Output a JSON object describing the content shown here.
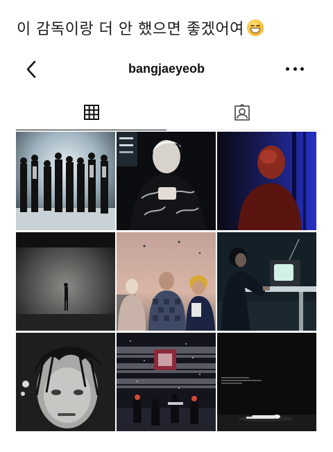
{
  "post": {
    "caption": "이 감독이랑 더 안 했으면 좋겠어여",
    "emoji": "grinning-face-with-smiling-eyes"
  },
  "profile": {
    "username": "bangjaeyeob"
  },
  "header": {
    "back_icon": "chevron-left-icon",
    "more_icon": "more-horizontal-icon"
  },
  "tabs": [
    {
      "id": "posts",
      "icon": "grid-icon",
      "selected": true
    },
    {
      "id": "tagged",
      "icon": "tagged-person-icon",
      "selected": false
    }
  ],
  "grid": {
    "rows": 3,
    "columns": 3,
    "tiles": [
      "group-stage-photo",
      "neon-jacket-portrait",
      "red-dark-blue-portrait",
      "silhouette-fog-photo",
      "three-men-pink-sky-photo",
      "man-with-retro-tv-photo",
      "bw-wet-hair-portrait",
      "concert-hall-performance-photo",
      "dark-stage-lying-figure-photo"
    ]
  },
  "colors": {
    "text": "#111111",
    "background": "#ffffff",
    "tab_border": "#e5e5e5"
  }
}
